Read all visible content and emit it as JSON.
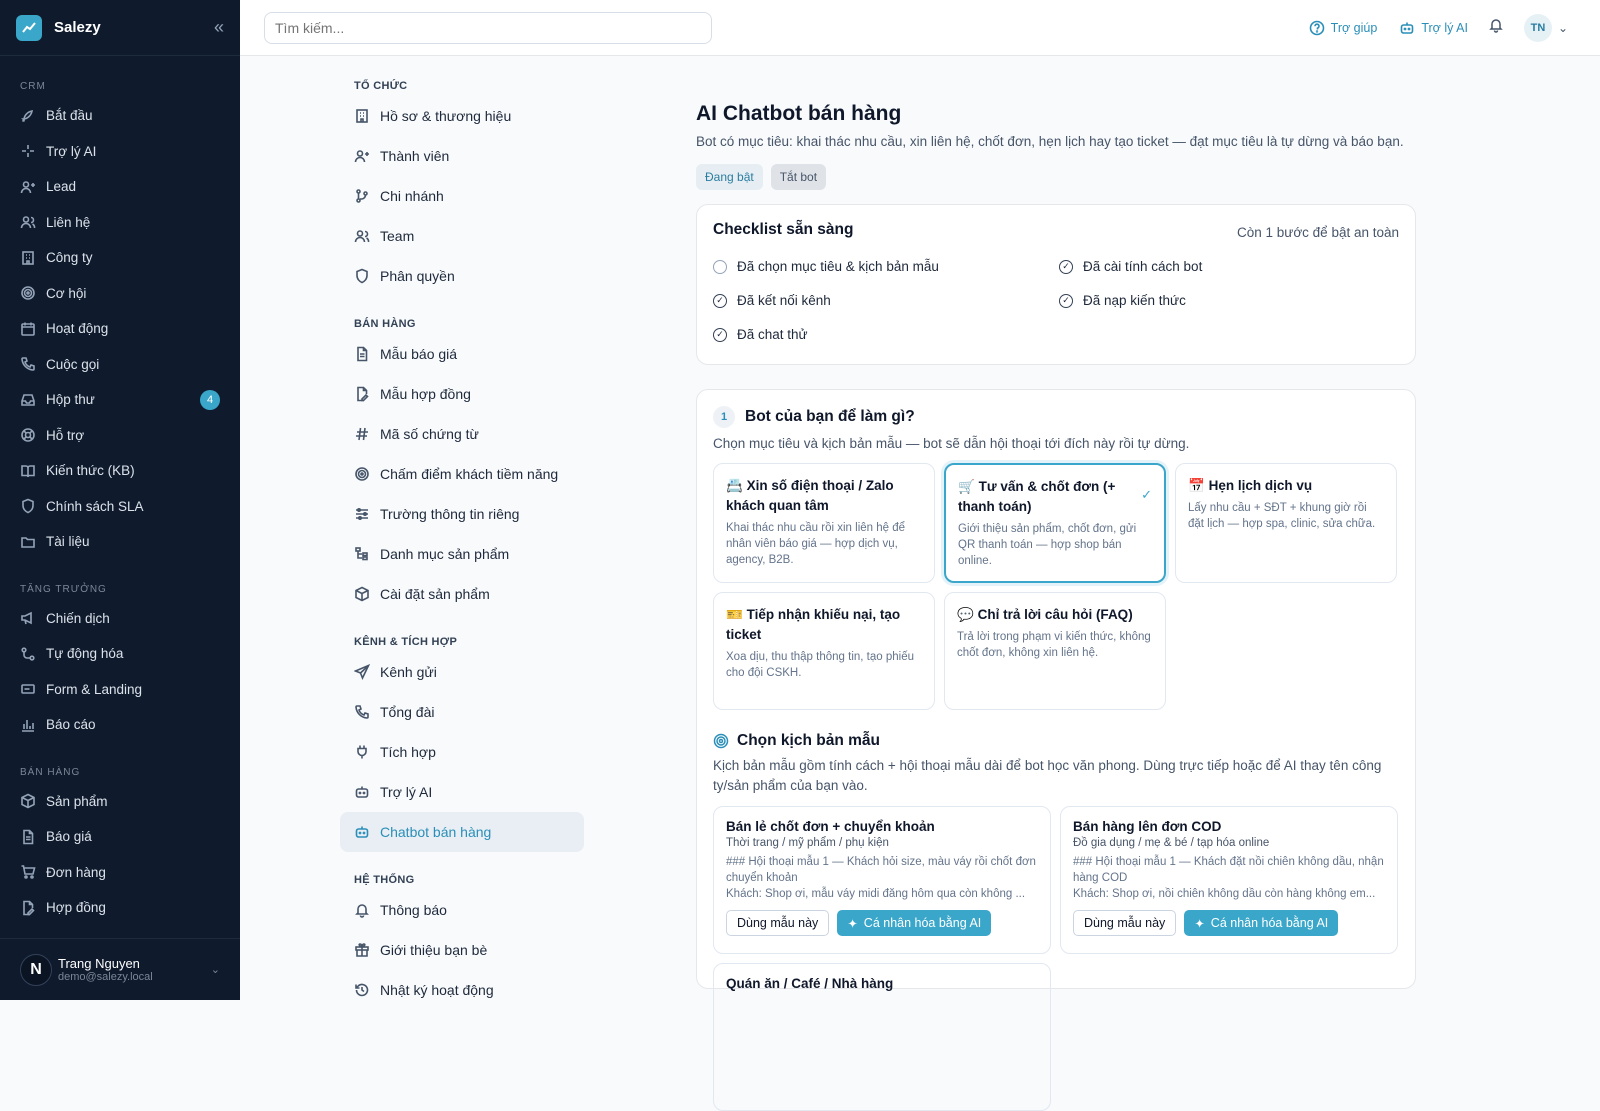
{
  "app": {
    "name": "Salezy"
  },
  "sidebar": {
    "sections": [
      {
        "title": "CRM",
        "items": [
          {
            "label": "Bắt đầu",
            "icon": "rocket-icon"
          },
          {
            "label": "Trợ lý AI",
            "icon": "sparkles-icon"
          },
          {
            "label": "Lead",
            "icon": "user-plus-icon"
          },
          {
            "label": "Liên hệ",
            "icon": "users-icon"
          },
          {
            "label": "Công ty",
            "icon": "building-icon"
          },
          {
            "label": "Cơ hội",
            "icon": "target-icon"
          },
          {
            "label": "Hoạt động",
            "icon": "calendar-icon"
          },
          {
            "label": "Cuộc gọi",
            "icon": "phone-icon"
          },
          {
            "label": "Hộp thư",
            "icon": "inbox-icon",
            "badge": "4"
          },
          {
            "label": "Hỗ trợ",
            "icon": "lifebuoy-icon"
          },
          {
            "label": "Kiến thức (KB)",
            "icon": "book-icon"
          },
          {
            "label": "Chính sách SLA",
            "icon": "shield-icon"
          },
          {
            "label": "Tài liệu",
            "icon": "folder-icon"
          }
        ]
      },
      {
        "title": "TĂNG TRƯỞNG",
        "items": [
          {
            "label": "Chiến dịch",
            "icon": "megaphone-icon"
          },
          {
            "label": "Tự động hóa",
            "icon": "workflow-icon"
          },
          {
            "label": "Form & Landing",
            "icon": "form-icon"
          },
          {
            "label": "Báo cáo",
            "icon": "bar-chart-icon"
          }
        ]
      },
      {
        "title": "BÁN HÀNG",
        "items": [
          {
            "label": "Sản phẩm",
            "icon": "package-icon"
          },
          {
            "label": "Báo giá",
            "icon": "file-icon"
          },
          {
            "label": "Đơn hàng",
            "icon": "cart-icon"
          },
          {
            "label": "Hợp đồng",
            "icon": "file-signature-icon"
          }
        ]
      }
    ],
    "user": {
      "initial": "N",
      "name": "Trang Nguyen",
      "email": "demo@salezy.local"
    }
  },
  "topbar": {
    "search_placeholder": "Tìm kiếm...",
    "help": "Trợ giúp",
    "ai": "Trợ lý AI",
    "avatar": "TN"
  },
  "settings_nav": [
    {
      "title": "TỔ CHỨC",
      "items": [
        {
          "label": "Hồ sơ & thương hiệu",
          "icon": "building-icon"
        },
        {
          "label": "Thành viên",
          "icon": "user-plus-icon"
        },
        {
          "label": "Chi nhánh",
          "icon": "git-branch-icon"
        },
        {
          "label": "Team",
          "icon": "users-icon"
        },
        {
          "label": "Phân quyền",
          "icon": "shield-icon"
        }
      ]
    },
    {
      "title": "BÁN HÀNG",
      "items": [
        {
          "label": "Mẫu báo giá",
          "icon": "file-icon"
        },
        {
          "label": "Mẫu hợp đồng",
          "icon": "file-signature-icon"
        },
        {
          "label": "Mã số chứng từ",
          "icon": "hash-icon"
        },
        {
          "label": "Chấm điểm khách tiềm năng",
          "icon": "target-icon"
        },
        {
          "label": "Trường thông tin riêng",
          "icon": "sliders-icon"
        },
        {
          "label": "Danh mục sản phẩm",
          "icon": "tree-icon"
        },
        {
          "label": "Cài đặt sản phẩm",
          "icon": "package-icon"
        }
      ]
    },
    {
      "title": "KÊNH & TÍCH HỢP",
      "items": [
        {
          "label": "Kênh gửi",
          "icon": "send-icon"
        },
        {
          "label": "Tổng đài",
          "icon": "phone-icon"
        },
        {
          "label": "Tích hợp",
          "icon": "plug-icon"
        },
        {
          "label": "Trợ lý AI",
          "icon": "bot-icon"
        },
        {
          "label": "Chatbot bán hàng",
          "icon": "bot-icon",
          "active": true
        }
      ]
    },
    {
      "title": "HỆ THỐNG",
      "items": [
        {
          "label": "Thông báo",
          "icon": "bell-icon"
        },
        {
          "label": "Giới thiệu bạn bè",
          "icon": "gift-icon"
        },
        {
          "label": "Nhật ký hoạt động",
          "icon": "history-icon"
        }
      ]
    }
  ],
  "page": {
    "title": "AI Chatbot bán hàng",
    "description": "Bot có mục tiêu: khai thác nhu cầu, xin liên hệ, chốt đơn, hẹn lịch hay tạo ticket — đạt mục tiêu là tự dừng và báo bạn.",
    "status_on": "Đang bật",
    "turn_off": "Tắt bot"
  },
  "checklist": {
    "title": "Checklist sẵn sàng",
    "remaining": "Còn 1 bước để bật an toàn",
    "items": [
      {
        "label": "Đã chọn mục tiêu & kịch bản mẫu",
        "done": false
      },
      {
        "label": "Đã cài tính cách bot",
        "done": true
      },
      {
        "label": "Đã kết nối kênh",
        "done": true
      },
      {
        "label": "Đã nạp kiến thức",
        "done": true
      },
      {
        "label": "Đã chat thử",
        "done": true
      }
    ]
  },
  "step1": {
    "number": "1",
    "title": "Bot của bạn để làm gì?",
    "subtitle": "Chọn mục tiêu và kịch bản mẫu — bot sẽ dẫn hội thoại tới đích này rồi tự dừng.",
    "goals": [
      {
        "emoji": "📇",
        "title": "Xin số điện thoại / Zalo khách quan tâm",
        "desc": "Khai thác nhu cầu rồi xin liên hệ để nhân viên báo giá — hợp dịch vụ, agency, B2B.",
        "selected": false
      },
      {
        "emoji": "🛒",
        "title": "Tư vấn & chốt đơn (+ thanh toán)",
        "desc": "Giới thiệu sản phẩm, chốt đơn, gửi QR thanh toán — hợp shop bán online.",
        "selected": true
      },
      {
        "emoji": "📅",
        "title": "Hẹn lịch dịch vụ",
        "desc": "Lấy nhu cầu + SĐT + khung giờ rồi đặt lịch — hợp spa, clinic, sửa chữa.",
        "selected": false
      },
      {
        "emoji": "🎫",
        "title": "Tiếp nhận khiếu nại, tạo ticket",
        "desc": "Xoa dịu, thu thập thông tin, tạo phiếu cho đội CSKH.",
        "selected": false
      },
      {
        "emoji": "💬",
        "title": "Chỉ trả lời câu hỏi (FAQ)",
        "desc": "Trả lời trong phạm vi kiến thức, không chốt đơn, không xin liên hệ.",
        "selected": false
      }
    ],
    "templates_title": "Chọn kịch bản mẫu",
    "templates_sub": "Kịch bản mẫu gồm tính cách + hội thoại mẫu dài để bot học văn phong. Dùng trực tiếp hoặc để AI thay tên công ty/sản phẩm của bạn vào.",
    "templates": [
      {
        "title": "Bán lẻ chốt đơn + chuyển khoản",
        "sub": "Thời trang / mỹ phẩm / phụ kiện",
        "body": "### Hội thoại mẫu 1 — Khách hỏi size, màu váy rồi chốt đơn chuyển khoản\nKhách: Shop ơi, mẫu váy midi đăng hôm qua còn không ..."
      },
      {
        "title": "Bán hàng lên đơn COD",
        "sub": "Đồ gia dụng / mẹ & bé / tạp hóa online",
        "body": "### Hội thoại mẫu 1 — Khách đặt nồi chiên không dầu, nhận hàng COD\nKhách: Shop ơi, nồi chiên không dầu còn hàng không em..."
      },
      {
        "title": "Quán ăn / Café / Nhà hàng",
        "sub": "",
        "body": ""
      }
    ],
    "use_btn": "Dùng mẫu này",
    "ai_btn": "Cá nhân hóa bằng AI"
  }
}
